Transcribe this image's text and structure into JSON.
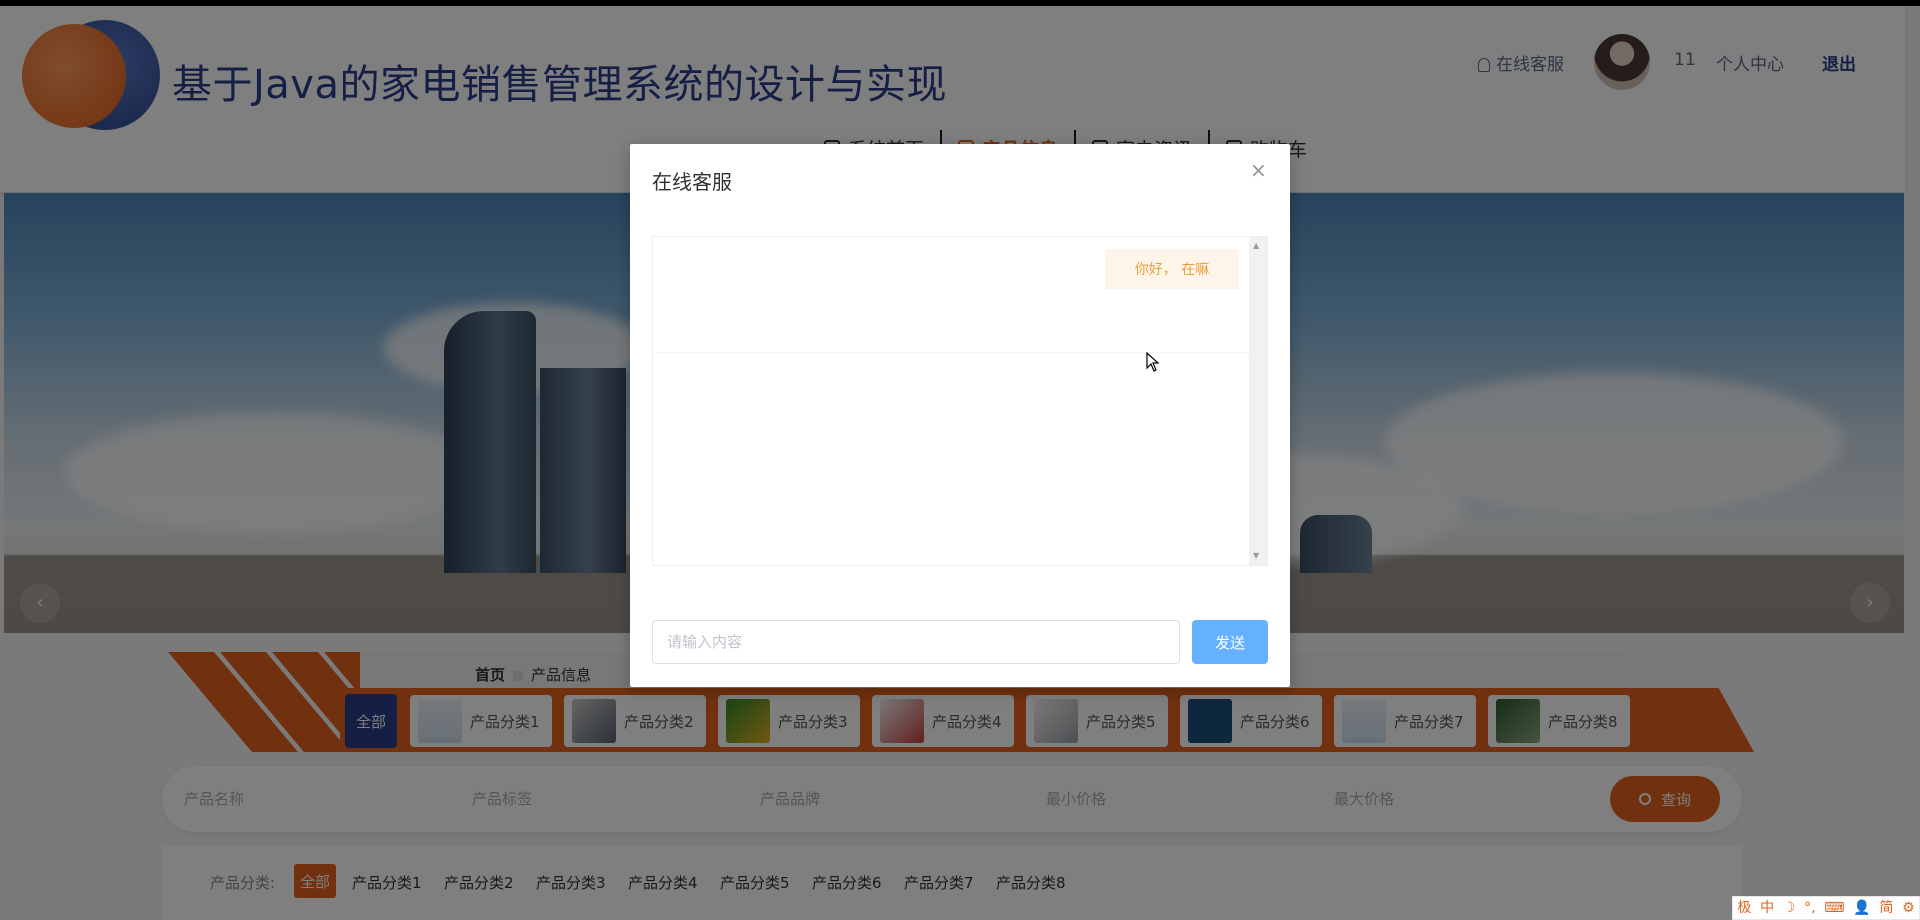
{
  "header": {
    "site_title": "基于Java的家电销售管理系统的设计与实现",
    "online_service": "在线客服",
    "user_id": "11",
    "personal_center": "个人中心",
    "logout": "退出"
  },
  "nav": {
    "items": [
      {
        "label": "系统首页",
        "active": false
      },
      {
        "label": "产品信息",
        "active": true
      },
      {
        "label": "家电资讯",
        "active": false
      },
      {
        "label": "购物车",
        "active": false
      }
    ]
  },
  "banner": {
    "prev_arrow": "‹",
    "next_arrow": "›"
  },
  "breadcrumb": {
    "home": "首页",
    "current": "产品信息"
  },
  "categories": {
    "all": "全部",
    "items": [
      "产品分类1",
      "产品分类2",
      "产品分类3",
      "产品分类4",
      "产品分类5",
      "产品分类6",
      "产品分类7",
      "产品分类8"
    ]
  },
  "search": {
    "fields": [
      "产品名称",
      "产品标签",
      "产品品牌",
      "最小价格",
      "最大价格"
    ],
    "button": "查询"
  },
  "filter": {
    "label": "产品分类:",
    "all": "全部",
    "items": [
      "产品分类1",
      "产品分类2",
      "产品分类3",
      "产品分类4",
      "产品分类5",
      "产品分类6",
      "产品分类7",
      "产品分类8"
    ]
  },
  "dialog": {
    "title": "在线客服",
    "close": "×",
    "messages": [
      {
        "text": "你好， 在嘛",
        "from": "user"
      }
    ],
    "input_placeholder": "请输入内容",
    "send": "发送"
  },
  "ime": {
    "items": [
      "极",
      "中",
      "☽",
      "°,",
      "⌨",
      "👤",
      "简",
      "⚙"
    ]
  },
  "colors": {
    "brand_blue": "#2a3e8c",
    "brand_orange": "#e2621c",
    "send_button": "#66b1ff",
    "bubble_bg": "#fdf5ea",
    "bubble_text": "#e6a23c"
  }
}
